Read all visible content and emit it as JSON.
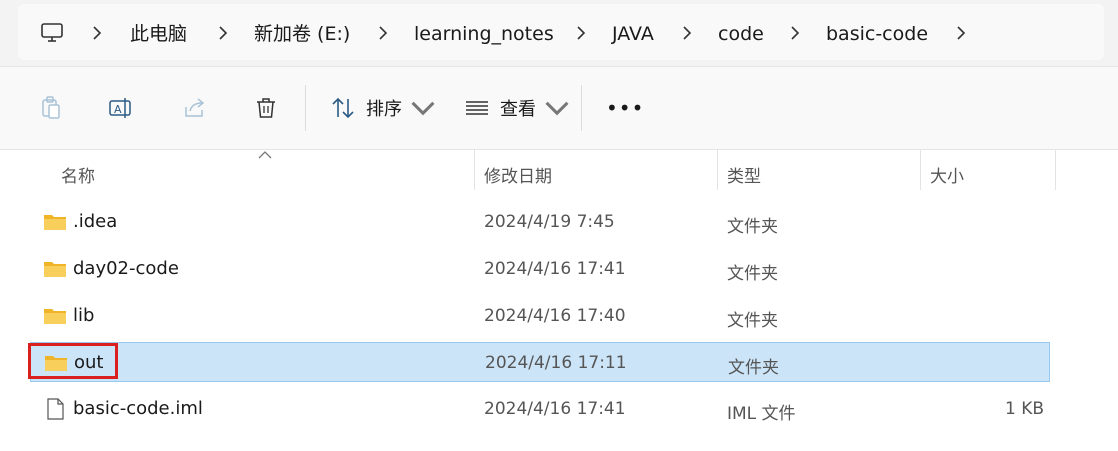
{
  "breadcrumb": {
    "items": [
      "此电脑",
      "新加卷 (E:)",
      "learning_notes",
      "JAVA",
      "code",
      "basic-code"
    ]
  },
  "toolbar": {
    "sort_label": "排序",
    "view_label": "查看",
    "more_label": "•••"
  },
  "columns": {
    "name": "名称",
    "date": "修改日期",
    "type": "类型",
    "size": "大小"
  },
  "files": [
    {
      "name": ".idea",
      "date": "2024/4/19 7:45",
      "type": "文件夹",
      "size": "",
      "icon": "folder-icon"
    },
    {
      "name": "day02-code",
      "date": "2024/4/16 17:41",
      "type": "文件夹",
      "size": "",
      "icon": "folder-icon"
    },
    {
      "name": "lib",
      "date": "2024/4/16 17:40",
      "type": "文件夹",
      "size": "",
      "icon": "folder-icon"
    },
    {
      "name": "out",
      "date": "2024/4/16 17:11",
      "type": "文件夹",
      "size": "",
      "icon": "folder-icon",
      "selected": true
    },
    {
      "name": "basic-code.iml",
      "date": "2024/4/16 17:41",
      "type": "IML 文件",
      "size": "1 KB",
      "icon": "file-icon"
    }
  ],
  "colors": {
    "selection_bg": "#cce4f7",
    "selection_border": "#99c9ef",
    "highlight_red": "#d9201e",
    "folder_yellow": "#f5c542"
  }
}
